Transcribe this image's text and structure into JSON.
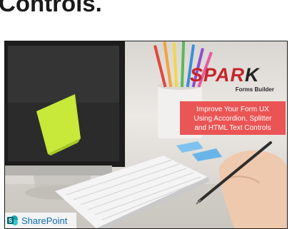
{
  "heading": {
    "text": "Controls."
  },
  "banner": {
    "logo": {
      "word_red": "SPAR",
      "word_dark": "K",
      "subtitle": "Forms Builder"
    },
    "promo_lines": [
      "Improve Your Form UX",
      "Using Accordion, Splitter",
      "and HTML Text Controls"
    ],
    "platform_badge": {
      "icon": "sharepoint-icon",
      "label": "SharePoint"
    }
  },
  "colors": {
    "brand_red": "#c5262a",
    "promo_background": "#e94848",
    "sharepoint_blue": "#0b6fb4"
  }
}
